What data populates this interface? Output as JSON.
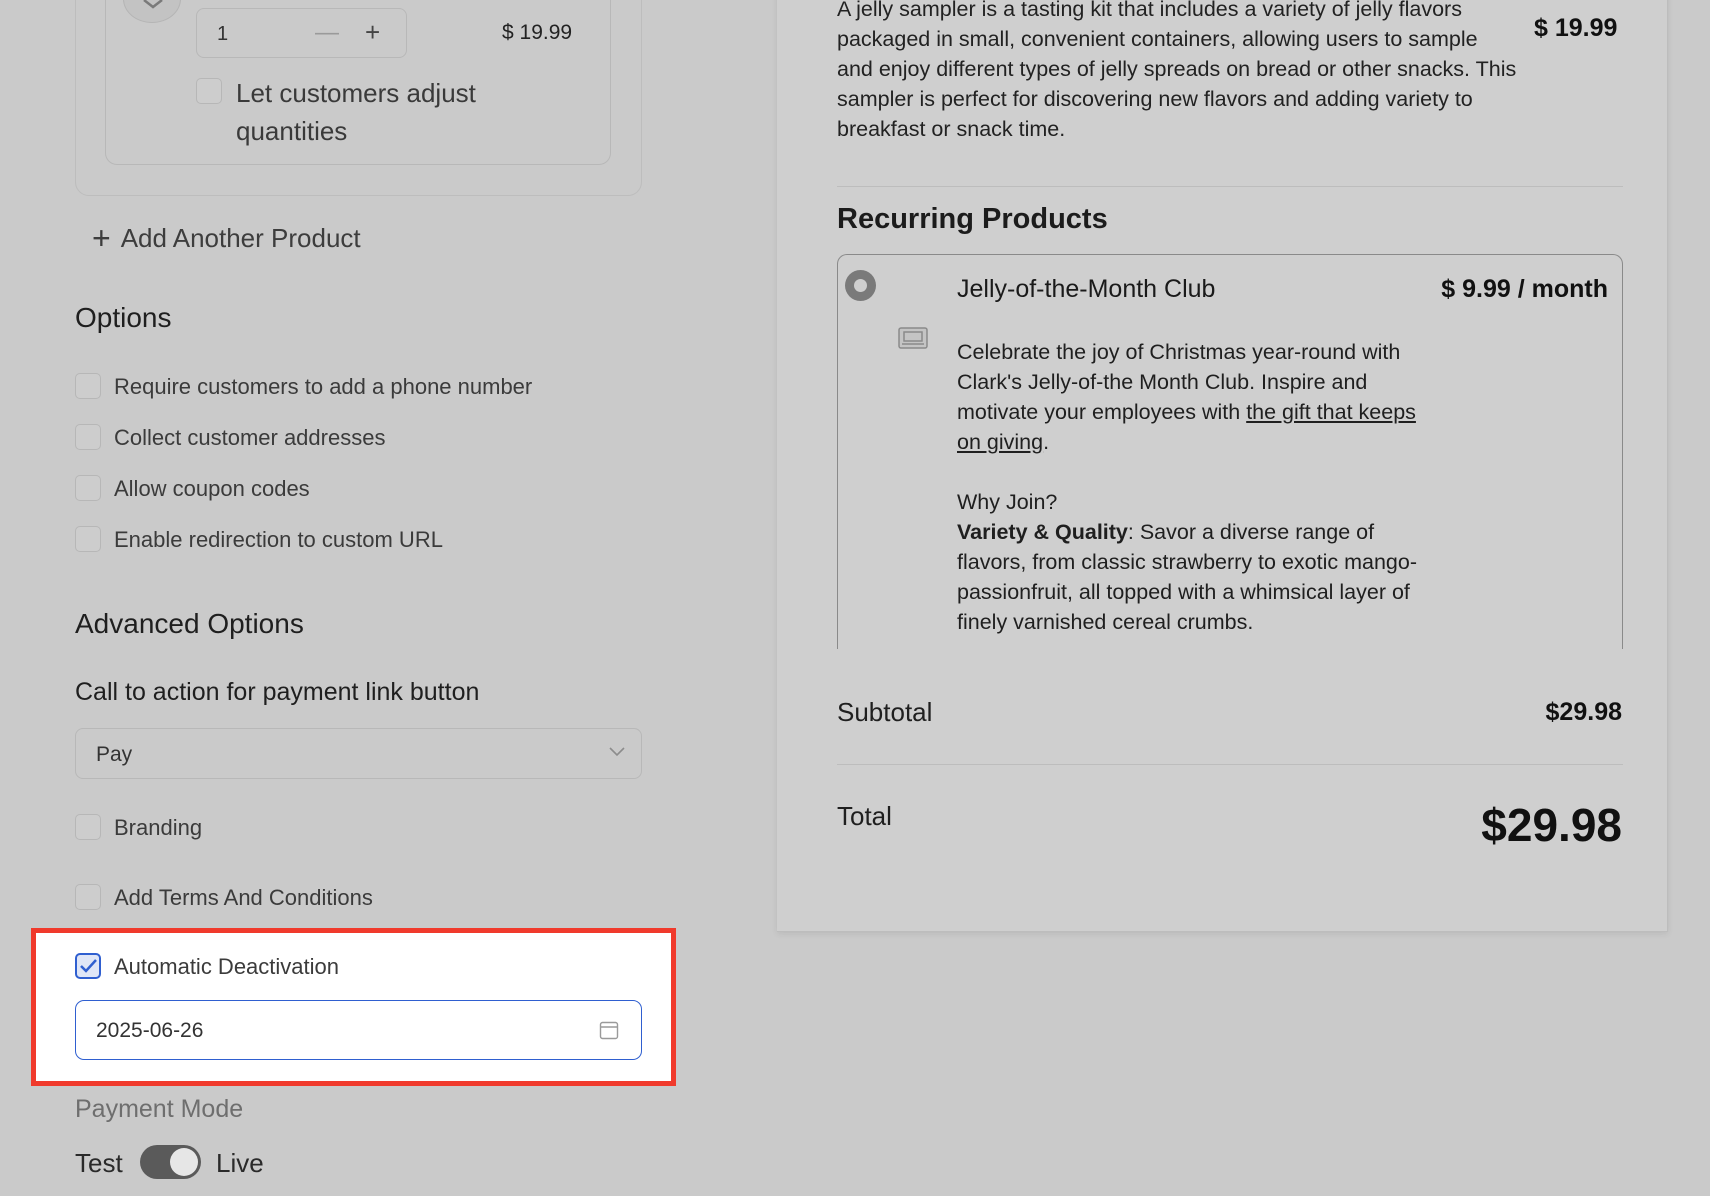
{
  "product": {
    "quantity": "1",
    "minus_symbol": "—",
    "plus_symbol": "+",
    "price": "$ 19.99",
    "adjust_label": "Let customers adjust quantities"
  },
  "add_product_label": "Add Another Product",
  "add_product_icon": "plus-icon",
  "options": {
    "title": "Options",
    "items": [
      "Require customers to add a phone number",
      "Collect customer addresses",
      "Allow coupon codes",
      "Enable redirection to custom URL"
    ]
  },
  "advanced": {
    "title": "Advanced Options",
    "cta_title": "Call to action for payment link button",
    "cta_value": "Pay",
    "branding_label": "Branding",
    "terms_label": "Add Terms And Conditions",
    "deactivation_label": "Automatic Deactivation",
    "deactivation_checked": true,
    "deactivation_date": "2025-06-26"
  },
  "payment_mode": {
    "title": "Payment Mode",
    "test_label": "Test",
    "live_label": "Live",
    "state": "live"
  },
  "preview": {
    "one_time_description": "A jelly sampler is a tasting kit that includes a variety of jelly flavors packaged in small, convenient containers, allowing users to sample and enjoy different types of jelly spreads on bread or other snacks. This sampler is perfect for discovering new flavors and adding variety to breakfast or snack time.",
    "one_time_price": "$ 19.99",
    "recurring_title": "Recurring Products",
    "recurring": {
      "name": "Jelly-of-the-Month Club",
      "price": "$ 9.99 / month",
      "desc_p1_pre": "Celebrate the joy of Christmas year-round with Clark's Jelly-of-the Month Club. Inspire and motivate your employees with ",
      "desc_p1_link": "the gift that keeps on giving",
      "desc_p1_post": ".",
      "why_join": "Why Join?",
      "variety_bold": "Variety & Quality",
      "variety_text": ": Savor a diverse range of flavors, from classic strawberry to exotic mango-passionfruit, all topped with a whimsical layer of finely varnished cereal crumbs."
    },
    "subtotal_label": "Subtotal",
    "subtotal_value": "$29.98",
    "total_label": "Total",
    "total_value": "$29.98"
  },
  "colors": {
    "highlight_border": "#f03a2c",
    "accent": "#2f5fd0",
    "background": "#cacaca"
  }
}
